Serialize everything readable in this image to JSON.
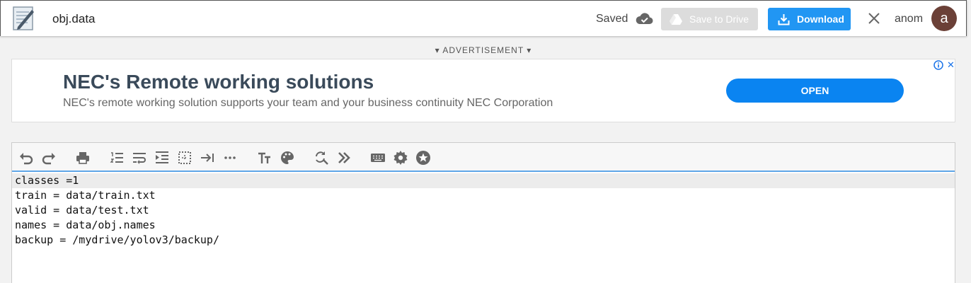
{
  "header": {
    "filename": "obj.data",
    "saved_label": "Saved",
    "save_to_drive_label": "Save to Drive",
    "download_label": "Download",
    "user_name": "anom",
    "avatar_letter": "a"
  },
  "ad": {
    "label": "▾ ADVERTISEMENT ▾",
    "title": "NEC's Remote working solutions",
    "description": "NEC's remote working solution supports your team and your business continuity NEC Corporation",
    "cta": "OPEN"
  },
  "toolbar": {
    "icons": [
      "undo-icon",
      "redo-icon",
      "print-icon",
      "line-numbers-icon",
      "word-wrap-icon",
      "indent-icon",
      "select-all-icon",
      "tab-icon",
      "more-icon",
      "font-size-icon",
      "palette-icon",
      "find-replace-icon",
      "jump-icon",
      "keyboard-icon",
      "settings-icon",
      "star-icon"
    ]
  },
  "editor": {
    "lines": [
      "classes =1",
      "train = data/train.txt",
      "valid = data/test.txt",
      "names = data/obj.names",
      "backup = /mydrive/yolov3/backup/"
    ]
  },
  "colors": {
    "download_button": "#2196f3",
    "ad_open_button": "#0a84f1",
    "avatar": "#6b4037"
  }
}
